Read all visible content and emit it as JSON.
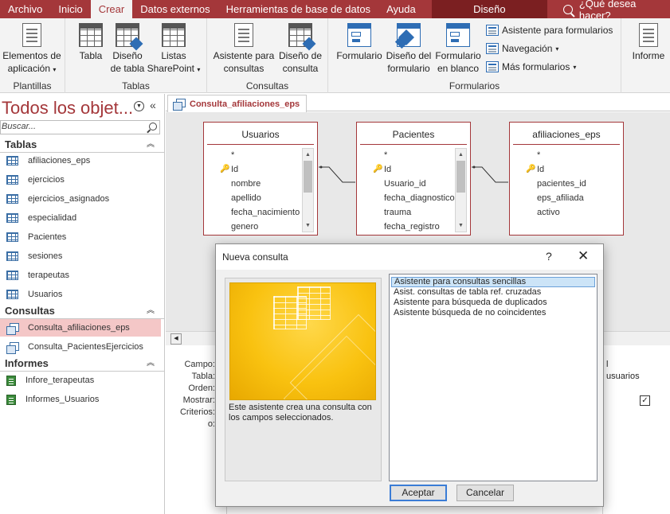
{
  "tabs": [
    "Archivo",
    "Inicio",
    "Crear",
    "Datos externos",
    "Herramientas de base de datos",
    "Ayuda"
  ],
  "active_tab": "Crear",
  "context_tab": "Diseño",
  "tellme": "¿Qué desea hacer?",
  "ribbon": {
    "groups": [
      "Plantillas",
      "Tablas",
      "Consultas",
      "Formularios"
    ],
    "buttons": {
      "app_parts": [
        "Elementos de",
        "aplicación"
      ],
      "tabla": "Tabla",
      "diseno_tabla": [
        "Diseño",
        "de tabla"
      ],
      "listas": [
        "Listas",
        "SharePoint"
      ],
      "asistente_consultas": [
        "Asistente para",
        "consultas"
      ],
      "diseno_consulta": [
        "Diseño de",
        "consulta"
      ],
      "formulario": "Formulario",
      "diseno_formulario": [
        "Diseño del",
        "formulario"
      ],
      "formulario_blanco": [
        "Formulario",
        "en blanco"
      ],
      "asistente_formularios": "Asistente para formularios",
      "navegacion": "Navegación",
      "mas_formularios": "Más formularios",
      "informe": "Informe"
    }
  },
  "nav": {
    "title": "Todos los objet...",
    "search_placeholder": "Buscar...",
    "sections": {
      "tablas": "Tablas",
      "consultas": "Consultas",
      "informes": "Informes"
    },
    "tables": [
      "afiliaciones_eps",
      "ejercicios",
      "ejercicios_asignados",
      "especialidad",
      "Pacientes",
      "sesiones",
      "terapeutas",
      "Usuarios"
    ],
    "queries": [
      "Consulta_afiliaciones_eps",
      "Consulta_PacientesEjercicios"
    ],
    "reports": [
      "Infore_terapeutas",
      "Informes_Usuarios"
    ]
  },
  "doc_tab": "Consulta_afiliaciones_eps",
  "tables": [
    {
      "name": "Usuarios",
      "fields": [
        "*",
        "Id",
        "nombre",
        "apellido",
        "fecha_nacimiento",
        "genero"
      ]
    },
    {
      "name": "Pacientes",
      "fields": [
        "*",
        "Id",
        "Usuario_id",
        "fecha_diagnostico",
        "trauma",
        "fecha_registro"
      ]
    },
    {
      "name": "afiliaciones_eps",
      "fields": [
        "*",
        "Id",
        "pacientes_id",
        "eps_afiliada",
        "activo"
      ]
    }
  ],
  "grid": {
    "labels": [
      "Campo:",
      "Tabla:",
      "Orden:",
      "Mostrar:",
      "Criterios:",
      "o:"
    ],
    "right_col": {
      "campo": "l",
      "tabla": "usuarios"
    },
    "check_mark": "✓"
  },
  "dialog": {
    "title": "Nueva consulta",
    "help": "?",
    "close": "✕",
    "description": "Este asistente crea una consulta con los campos seleccionados.",
    "options": [
      "Asistente para consultas sencillas",
      "Asist. consultas de tabla ref. cruzadas",
      "Asistente para búsqueda de duplicados",
      "Asistente búsqueda de no coincidentes"
    ],
    "selected_index": 0,
    "ok": "Aceptar",
    "cancel": "Cancelar"
  },
  "colors": {
    "accent": "#a4373a",
    "selection": "#cce4f7",
    "nav_selected": "#f4c7c7"
  }
}
